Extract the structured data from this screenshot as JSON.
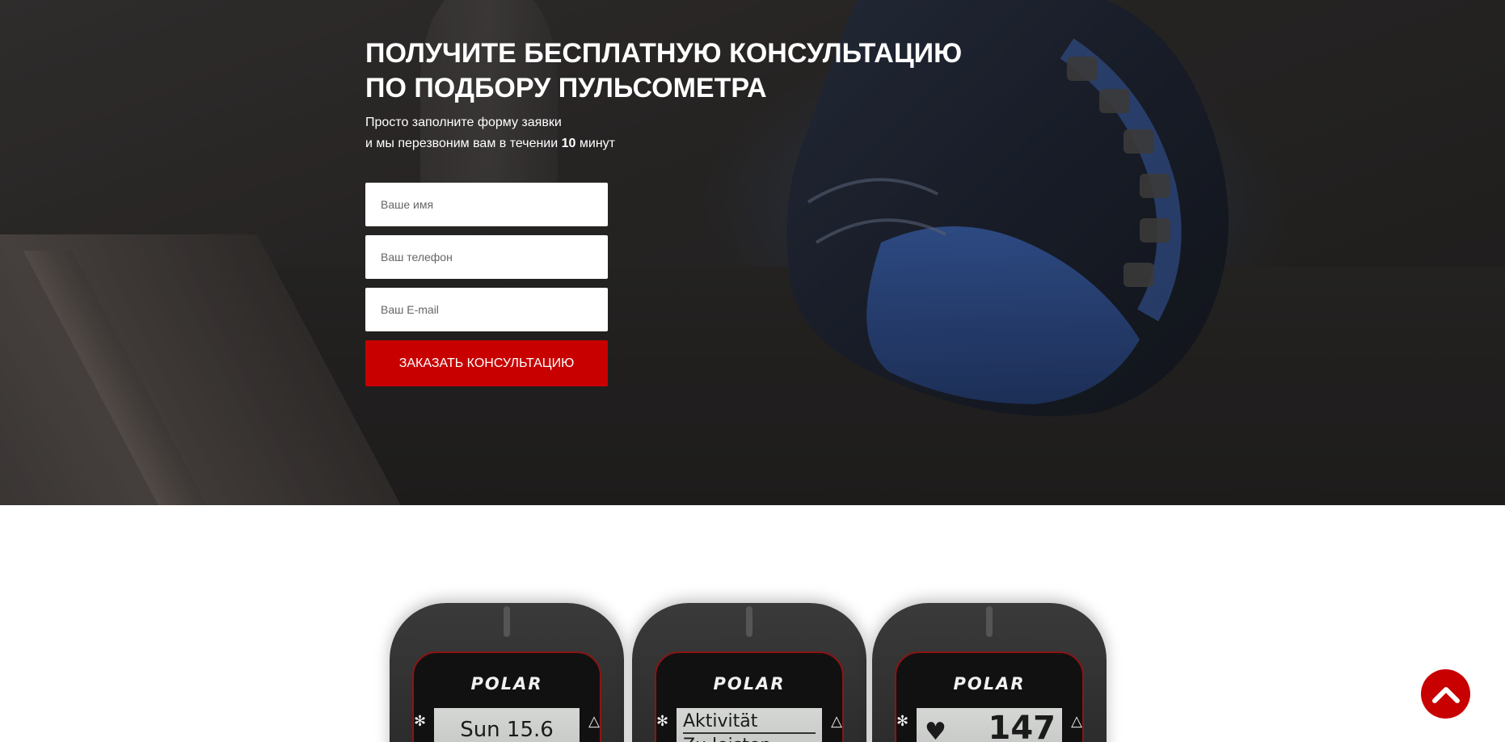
{
  "hero": {
    "title_line1": "ПОЛУЧИТЕ БЕСПЛАТНУЮ КОНСУЛЬТАЦИЮ",
    "title_line2": "ПО ПОДБОРУ ПУЛЬСОМЕТРА",
    "subtitle_line1": "Просто заполните форму заявки",
    "subtitle_line2_prefix": "и мы перезвоним вам в течении",
    "subtitle_line2_bold": "10",
    "subtitle_line2_suffix": "минут"
  },
  "form": {
    "name_placeholder": "Ваше имя",
    "phone_placeholder": "Ваш телефон",
    "email_placeholder": "Ваш E-mail",
    "submit_label": "ЗАКАЗАТЬ КОНСУЛЬТАЦИЮ"
  },
  "watches": [
    {
      "brand": "POLAR",
      "screen_text": "Sun 15.6"
    },
    {
      "brand": "POLAR",
      "screen_line1": "Aktivität",
      "screen_line2": "Zu leisten"
    },
    {
      "brand": "POLAR",
      "screen_text": "147"
    }
  ],
  "colors": {
    "accent": "#c90000",
    "hero_overlay": "#2f2c2b"
  },
  "icons": {
    "scroll_top": "chevron-up-icon"
  }
}
